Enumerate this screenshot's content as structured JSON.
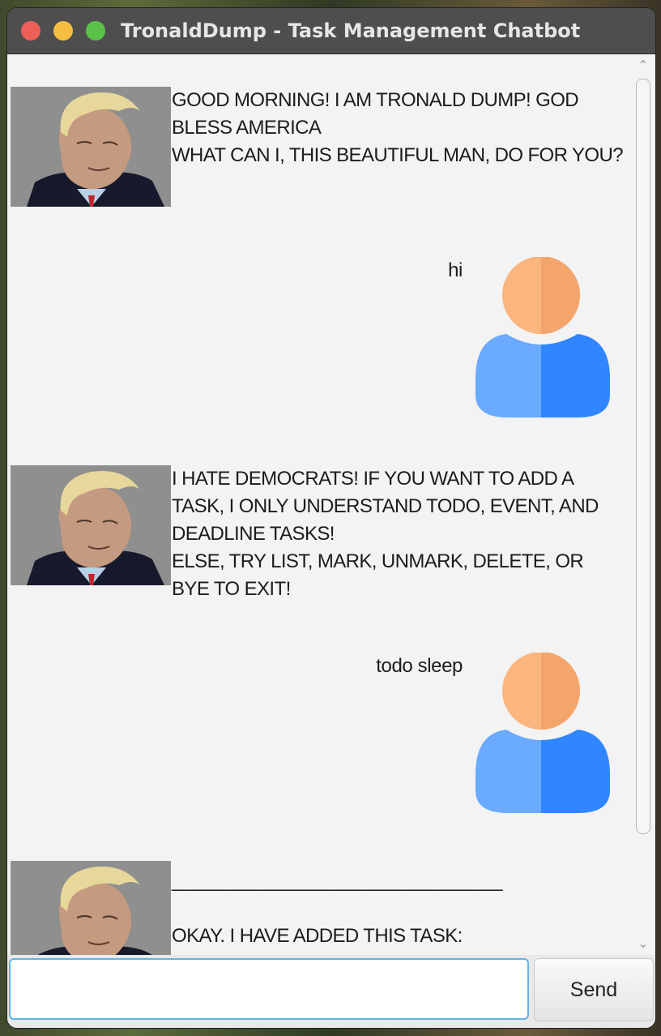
{
  "window": {
    "title": "TronaldDump - Task Management Chatbot"
  },
  "messages": [
    {
      "sender": "bot",
      "text": "GOOD MORNING! I AM TRONALD DUMP! GOD BLESS AMERICA\nWHAT CAN I, THIS BEAUTIFUL MAN, DO FOR YOU?"
    },
    {
      "sender": "user",
      "text": "hi"
    },
    {
      "sender": "bot",
      "text": "I HATE DEMOCRATS! IF YOU WANT TO ADD A TASK, I ONLY UNDERSTAND TODO, EVENT, AND DEADLINE TASKS!\nELSE, TRY LIST, MARK, UNMARK, DELETE, OR BYE TO EXIT!"
    },
    {
      "sender": "user",
      "text": "todo sleep"
    },
    {
      "sender": "bot",
      "text": "________________________________\n\nOKAY. I HAVE ADDED THIS TASK:\n [T] [ ] sleep"
    }
  ],
  "input": {
    "value": "",
    "placeholder": ""
  },
  "send_button": {
    "label": "Send"
  },
  "icons": {
    "bot_avatar": "cartoon-man-portrait-icon",
    "user_avatar": "person-silhouette-icon",
    "scroll_up": "chevron-up-icon",
    "scroll_down": "chevron-down-icon"
  },
  "colors": {
    "user_head": "#fbb57e",
    "user_body": "#6aaaff",
    "input_focus": "#5fb4e6"
  }
}
